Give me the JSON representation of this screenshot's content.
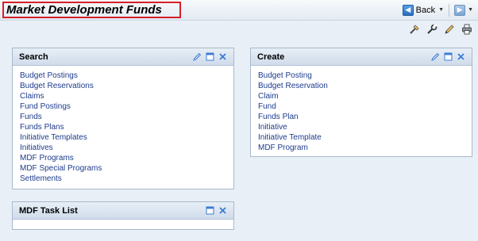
{
  "header": {
    "title": "Market Development Funds",
    "back_label": "Back"
  },
  "toolbar": {
    "icons": [
      "personalize-icon",
      "settings-icon",
      "edit-icon",
      "print-icon"
    ]
  },
  "search": {
    "title": "Search",
    "links": [
      "Budget Postings",
      "Budget Reservations",
      "Claims",
      "Fund Postings",
      "Funds",
      "Funds Plans",
      "Initiative Templates",
      "Initiatives",
      "MDF Programs",
      "MDF Special Programs",
      "Settlements"
    ]
  },
  "create": {
    "title": "Create",
    "links": [
      "Budget Posting",
      "Budget Reservation",
      "Claim",
      "Fund",
      "Funds Plan",
      "Initiative",
      "Initiative Template",
      "MDF Program"
    ]
  },
  "tasklist": {
    "title": "MDF Task List"
  },
  "colors": {
    "background": "#e9eff6",
    "link": "#1d3b8c",
    "title_highlight": "#d4202a",
    "control_blue": "#2a6fc0"
  }
}
